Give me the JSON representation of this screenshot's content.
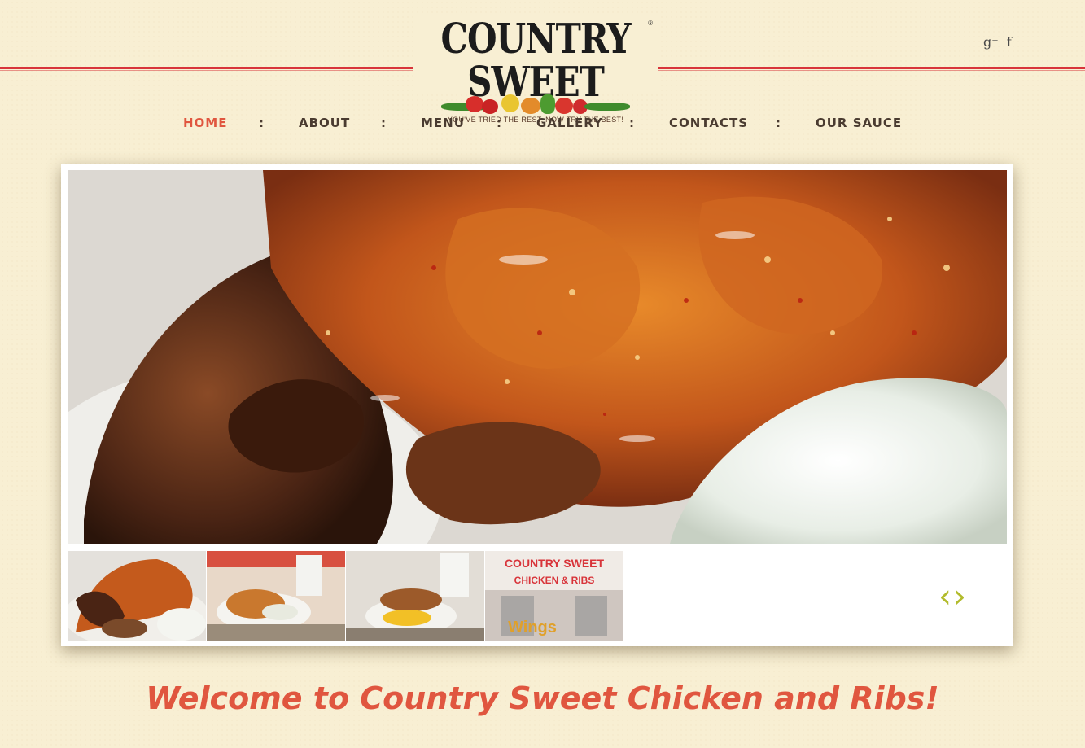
{
  "logo": {
    "title": "COUNTRY SWEET",
    "registered": "®",
    "tagline": "YOU'VE TRIED THE REST, NOW TRY THE BEST!"
  },
  "social": {
    "google_plus": "g⁺",
    "facebook": "f"
  },
  "nav": {
    "items": [
      {
        "label": "HOME",
        "active": true
      },
      {
        "label": "ABOUT",
        "active": false
      },
      {
        "label": "MENU",
        "active": false
      },
      {
        "label": "GALLERY",
        "active": false
      },
      {
        "label": "CONTACTS",
        "active": false
      },
      {
        "label": "OUR SAUCE",
        "active": false
      }
    ],
    "separator": ":"
  },
  "slider": {
    "hero_description": "plate of sauced fried chicken, ribs and coleslaw",
    "thumbnails": [
      {
        "name": "thumb-chicken-ribs"
      },
      {
        "name": "thumb-wings-plate"
      },
      {
        "name": "thumb-chicken-mac"
      },
      {
        "name": "thumb-storefront",
        "sign_text": "COUNTRY SWEET",
        "sign_sub": "CHICKEN & RIBS",
        "window_text": "Wings"
      }
    ],
    "prev_label": "‹",
    "next_label": "›"
  },
  "welcome": {
    "heading": "Welcome to Country Sweet Chicken and Ribs!"
  },
  "colors": {
    "accent": "#e0563f",
    "rule": "#d8343a",
    "arrows": "#b2bb2c",
    "background": "#f8efd3"
  }
}
